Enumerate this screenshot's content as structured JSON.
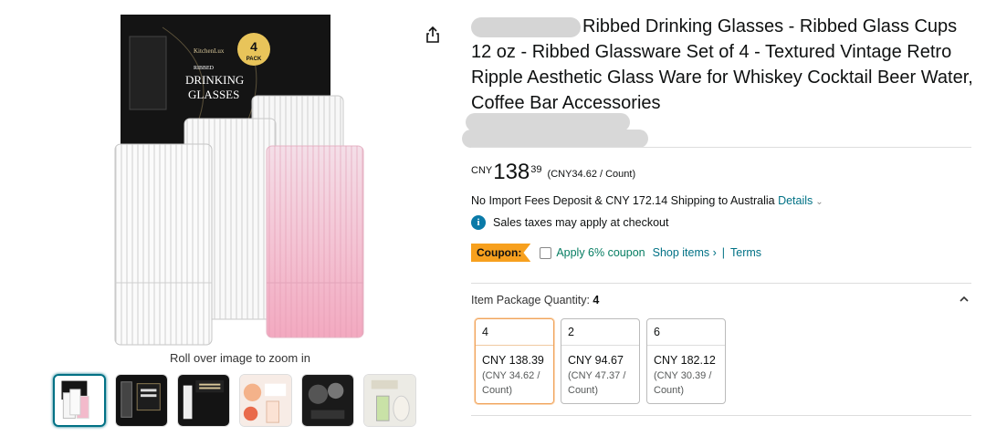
{
  "gallery": {
    "zoom_hint": "Roll over image to zoom in",
    "box_brand": "KitchenLux",
    "box_line1": "DRINKING",
    "box_line2": "GLASSES",
    "box_small": "RIBBED",
    "badge_num": "4",
    "badge_text": "PACK",
    "thumbnails": [
      "thumb-1",
      "thumb-2",
      "thumb-3",
      "thumb-4",
      "thumb-5",
      "thumb-6"
    ]
  },
  "product": {
    "title": "Ribbed Drinking Glasses - Ribbed Glass Cups 12 oz - Ribbed Glassware Set of 4 - Textured Vintage Retro Ripple Aesthetic Glass Ware for Whiskey Cocktail Beer Water, Coffee Bar Accessories"
  },
  "price": {
    "currency": "CNY",
    "whole": "138",
    "fraction": "39",
    "unit_price": "(CNY34.62 / Count)"
  },
  "shipping": {
    "text": "No Import Fees Deposit & CNY 172.14 Shipping to Australia",
    "details_link": "Details"
  },
  "tax": {
    "text": "Sales taxes may apply at checkout"
  },
  "coupon": {
    "tag": "Coupon:",
    "apply_text": "Apply 6% coupon",
    "shop_items": "Shop items ›",
    "separator": "|",
    "terms": "Terms"
  },
  "quantity": {
    "label": "Item Package Quantity:",
    "selected": "4",
    "options": [
      {
        "qty": "4",
        "price": "CNY 138.39",
        "unit": "(CNY 34.62 / Count)",
        "selected": true
      },
      {
        "qty": "2",
        "price": "CNY 94.67",
        "unit": "(CNY 47.37 / Count)",
        "selected": false
      },
      {
        "qty": "6",
        "price": "CNY 182.12",
        "unit": "(CNY 30.39 / Count)",
        "selected": false
      }
    ]
  },
  "colors": {
    "link": "#007185",
    "coupon": "#f7a01e",
    "green": "#067d62",
    "selected_border": "#f0a35b"
  }
}
